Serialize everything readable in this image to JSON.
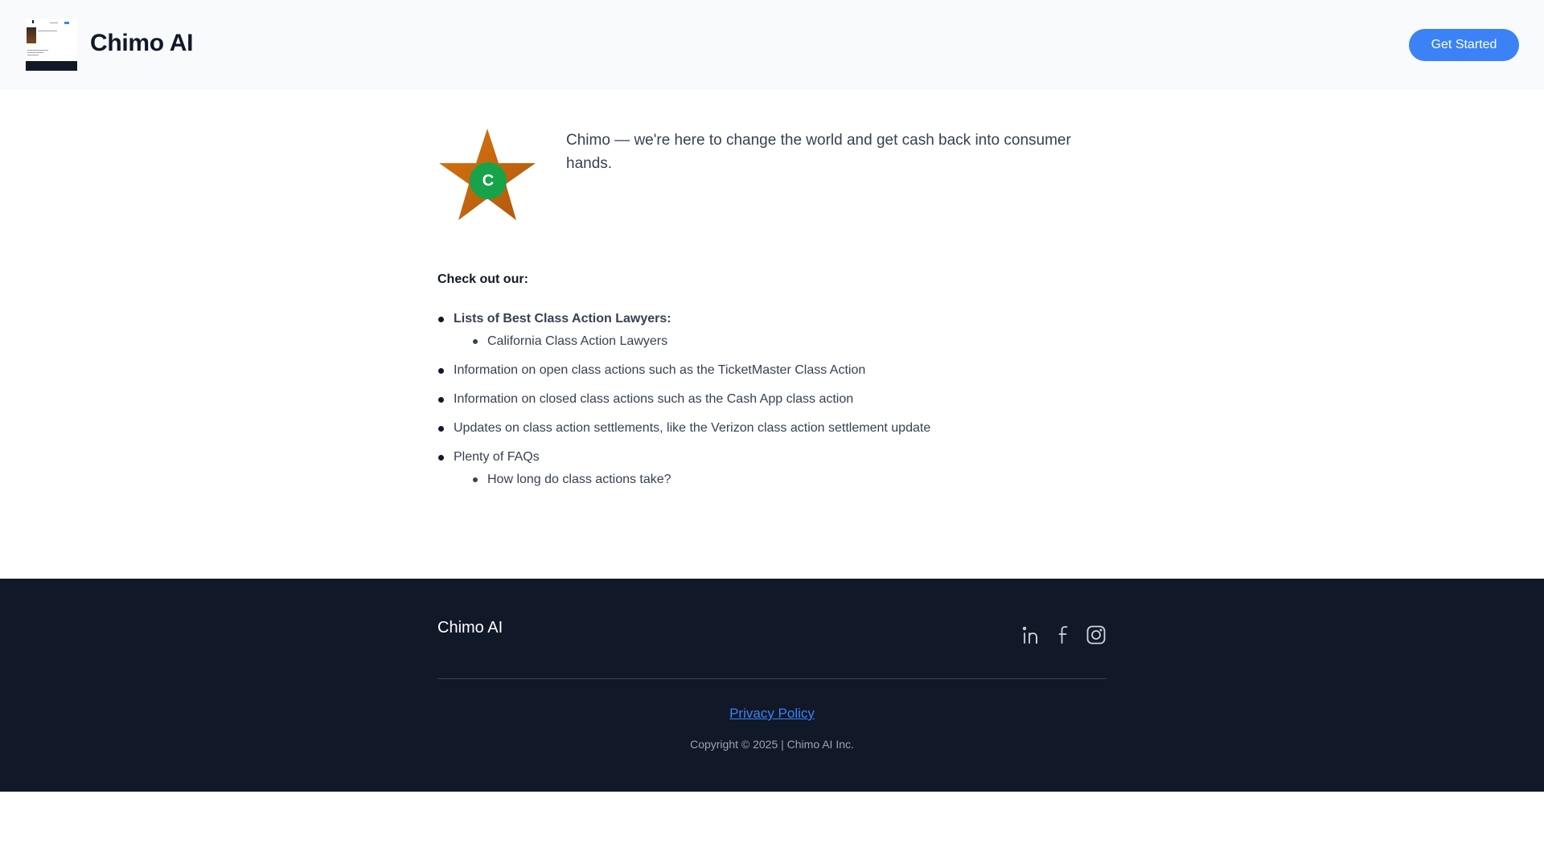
{
  "header": {
    "brand": "Chimo AI",
    "cta_label": "Get Started"
  },
  "hero": {
    "star_letter": "C",
    "tagline": "Chimo — we're here to change the world and get cash back into consumer hands."
  },
  "content": {
    "heading": "Check out our:",
    "items": [
      {
        "label": "Lists of Best Class Action Lawyers:",
        "sub": [
          "California Class Action Lawyers"
        ]
      },
      {
        "label": "Information on open class actions such as the TicketMaster Class Action"
      },
      {
        "label": "Information on closed class actions such as the Cash App class action"
      },
      {
        "label": "Updates on class action settlements, like the Verizon class action settlement update"
      },
      {
        "label": "Plenty of FAQs",
        "sub": [
          "How long do class actions take?"
        ]
      }
    ]
  },
  "footer": {
    "brand": "Chimo AI",
    "social_icons": [
      "linkedin-icon",
      "facebook-icon",
      "instagram-icon"
    ],
    "privacy_label": "Privacy Policy",
    "copyright": "Copyright © 2025 | Chimo AI Inc."
  },
  "colors": {
    "accent": "#3b82f6",
    "footer_bg": "#111827",
    "header_bg": "#f8fafc",
    "star_fill": "#c2650f",
    "badge_green": "#16a34a"
  }
}
